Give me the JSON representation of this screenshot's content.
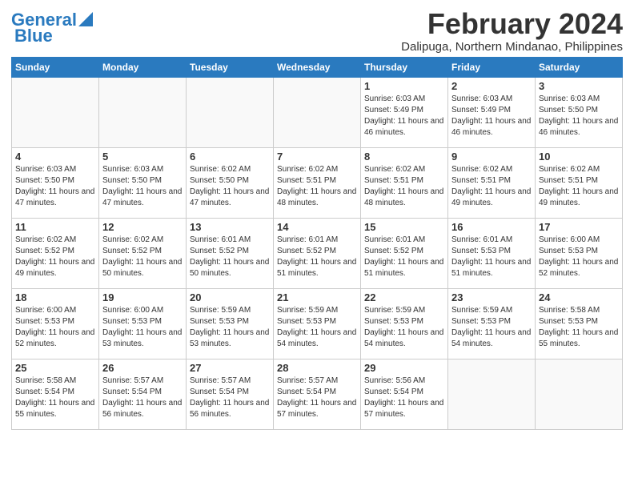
{
  "header": {
    "logo_line1": "General",
    "logo_line2": "Blue",
    "month": "February 2024",
    "location": "Dalipuga, Northern Mindanao, Philippines"
  },
  "days_of_week": [
    "Sunday",
    "Monday",
    "Tuesday",
    "Wednesday",
    "Thursday",
    "Friday",
    "Saturday"
  ],
  "weeks": [
    [
      {
        "day": "",
        "info": ""
      },
      {
        "day": "",
        "info": ""
      },
      {
        "day": "",
        "info": ""
      },
      {
        "day": "",
        "info": ""
      },
      {
        "day": "1",
        "info": "Sunrise: 6:03 AM\nSunset: 5:49 PM\nDaylight: 11 hours and 46 minutes."
      },
      {
        "day": "2",
        "info": "Sunrise: 6:03 AM\nSunset: 5:49 PM\nDaylight: 11 hours and 46 minutes."
      },
      {
        "day": "3",
        "info": "Sunrise: 6:03 AM\nSunset: 5:50 PM\nDaylight: 11 hours and 46 minutes."
      }
    ],
    [
      {
        "day": "4",
        "info": "Sunrise: 6:03 AM\nSunset: 5:50 PM\nDaylight: 11 hours and 47 minutes."
      },
      {
        "day": "5",
        "info": "Sunrise: 6:03 AM\nSunset: 5:50 PM\nDaylight: 11 hours and 47 minutes."
      },
      {
        "day": "6",
        "info": "Sunrise: 6:02 AM\nSunset: 5:50 PM\nDaylight: 11 hours and 47 minutes."
      },
      {
        "day": "7",
        "info": "Sunrise: 6:02 AM\nSunset: 5:51 PM\nDaylight: 11 hours and 48 minutes."
      },
      {
        "day": "8",
        "info": "Sunrise: 6:02 AM\nSunset: 5:51 PM\nDaylight: 11 hours and 48 minutes."
      },
      {
        "day": "9",
        "info": "Sunrise: 6:02 AM\nSunset: 5:51 PM\nDaylight: 11 hours and 49 minutes."
      },
      {
        "day": "10",
        "info": "Sunrise: 6:02 AM\nSunset: 5:51 PM\nDaylight: 11 hours and 49 minutes."
      }
    ],
    [
      {
        "day": "11",
        "info": "Sunrise: 6:02 AM\nSunset: 5:52 PM\nDaylight: 11 hours and 49 minutes."
      },
      {
        "day": "12",
        "info": "Sunrise: 6:02 AM\nSunset: 5:52 PM\nDaylight: 11 hours and 50 minutes."
      },
      {
        "day": "13",
        "info": "Sunrise: 6:01 AM\nSunset: 5:52 PM\nDaylight: 11 hours and 50 minutes."
      },
      {
        "day": "14",
        "info": "Sunrise: 6:01 AM\nSunset: 5:52 PM\nDaylight: 11 hours and 51 minutes."
      },
      {
        "day": "15",
        "info": "Sunrise: 6:01 AM\nSunset: 5:52 PM\nDaylight: 11 hours and 51 minutes."
      },
      {
        "day": "16",
        "info": "Sunrise: 6:01 AM\nSunset: 5:53 PM\nDaylight: 11 hours and 51 minutes."
      },
      {
        "day": "17",
        "info": "Sunrise: 6:00 AM\nSunset: 5:53 PM\nDaylight: 11 hours and 52 minutes."
      }
    ],
    [
      {
        "day": "18",
        "info": "Sunrise: 6:00 AM\nSunset: 5:53 PM\nDaylight: 11 hours and 52 minutes."
      },
      {
        "day": "19",
        "info": "Sunrise: 6:00 AM\nSunset: 5:53 PM\nDaylight: 11 hours and 53 minutes."
      },
      {
        "day": "20",
        "info": "Sunrise: 5:59 AM\nSunset: 5:53 PM\nDaylight: 11 hours and 53 minutes."
      },
      {
        "day": "21",
        "info": "Sunrise: 5:59 AM\nSunset: 5:53 PM\nDaylight: 11 hours and 54 minutes."
      },
      {
        "day": "22",
        "info": "Sunrise: 5:59 AM\nSunset: 5:53 PM\nDaylight: 11 hours and 54 minutes."
      },
      {
        "day": "23",
        "info": "Sunrise: 5:59 AM\nSunset: 5:53 PM\nDaylight: 11 hours and 54 minutes."
      },
      {
        "day": "24",
        "info": "Sunrise: 5:58 AM\nSunset: 5:53 PM\nDaylight: 11 hours and 55 minutes."
      }
    ],
    [
      {
        "day": "25",
        "info": "Sunrise: 5:58 AM\nSunset: 5:54 PM\nDaylight: 11 hours and 55 minutes."
      },
      {
        "day": "26",
        "info": "Sunrise: 5:57 AM\nSunset: 5:54 PM\nDaylight: 11 hours and 56 minutes."
      },
      {
        "day": "27",
        "info": "Sunrise: 5:57 AM\nSunset: 5:54 PM\nDaylight: 11 hours and 56 minutes."
      },
      {
        "day": "28",
        "info": "Sunrise: 5:57 AM\nSunset: 5:54 PM\nDaylight: 11 hours and 57 minutes."
      },
      {
        "day": "29",
        "info": "Sunrise: 5:56 AM\nSunset: 5:54 PM\nDaylight: 11 hours and 57 minutes."
      },
      {
        "day": "",
        "info": ""
      },
      {
        "day": "",
        "info": ""
      }
    ]
  ]
}
